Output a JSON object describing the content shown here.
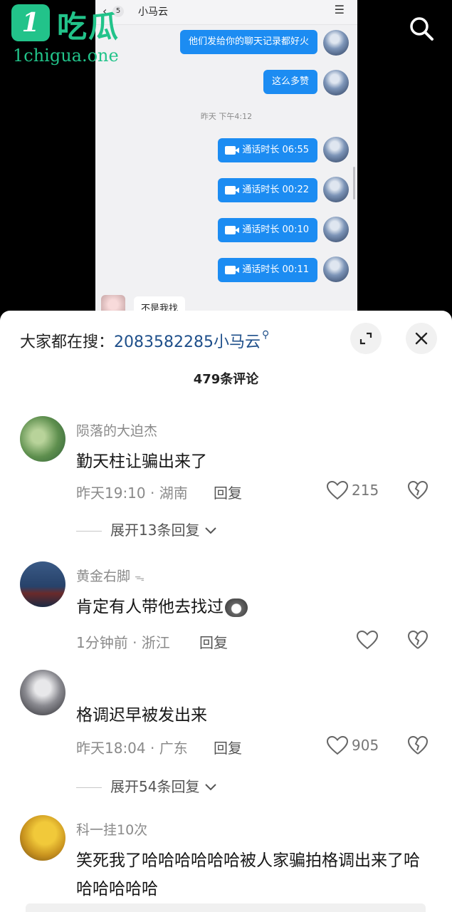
{
  "watermark": {
    "badge": "1",
    "title": "吃瓜",
    "url": "1chigua.one"
  },
  "chat": {
    "back_count": "5",
    "contact_name": "小马云",
    "messages": [
      {
        "text": "他们发给你的聊天记录都好火"
      },
      {
        "text": "这么多赞"
      }
    ],
    "timestamp": "昨天 下午4:12",
    "calls": [
      {
        "text": "通话时长 06:55"
      },
      {
        "text": "通话时长 00:22"
      },
      {
        "text": "通话时长 00:10"
      },
      {
        "text": "通话时长 00:11"
      }
    ],
    "incoming_partial": "不是我找"
  },
  "sheet": {
    "search_prefix": "大家都在搜：",
    "search_query": "2083582285小马云",
    "comment_count": "479条评论",
    "comments": [
      {
        "user": "陨落的大迫杰",
        "text": "勤天柱让骗出来了",
        "meta": "昨天19:10 · 湖南",
        "reply": "回复",
        "likes": "215",
        "expand": "展开13条回复"
      },
      {
        "user": "黄金右脚",
        "text": "肯定有人带他去找过",
        "meta": "1分钟前 · 浙江",
        "reply": "回复",
        "likes": "",
        "expand": ""
      },
      {
        "user": "",
        "text": "格调迟早被发出来",
        "meta": "昨天18:04 · 广东",
        "reply": "回复",
        "likes": "905",
        "expand": "展开54条回复"
      },
      {
        "user": "科一挂10次",
        "text": "笑死我了哈哈哈哈哈哈被人家骗拍格调出来了哈哈哈哈哈哈",
        "meta": "",
        "reply": "",
        "likes": "",
        "expand": ""
      }
    ]
  },
  "icons": {
    "search": "search-icon",
    "expand": "expand-icon",
    "close": "close-icon",
    "like": "heart-icon",
    "dislike": "broken-heart-icon",
    "chevron": "chevron-down-icon",
    "camera": "video-camera-icon"
  },
  "colors": {
    "accent": "#1c8cf2",
    "watermark": "#22c38a",
    "search_link": "#1e4f8a"
  }
}
